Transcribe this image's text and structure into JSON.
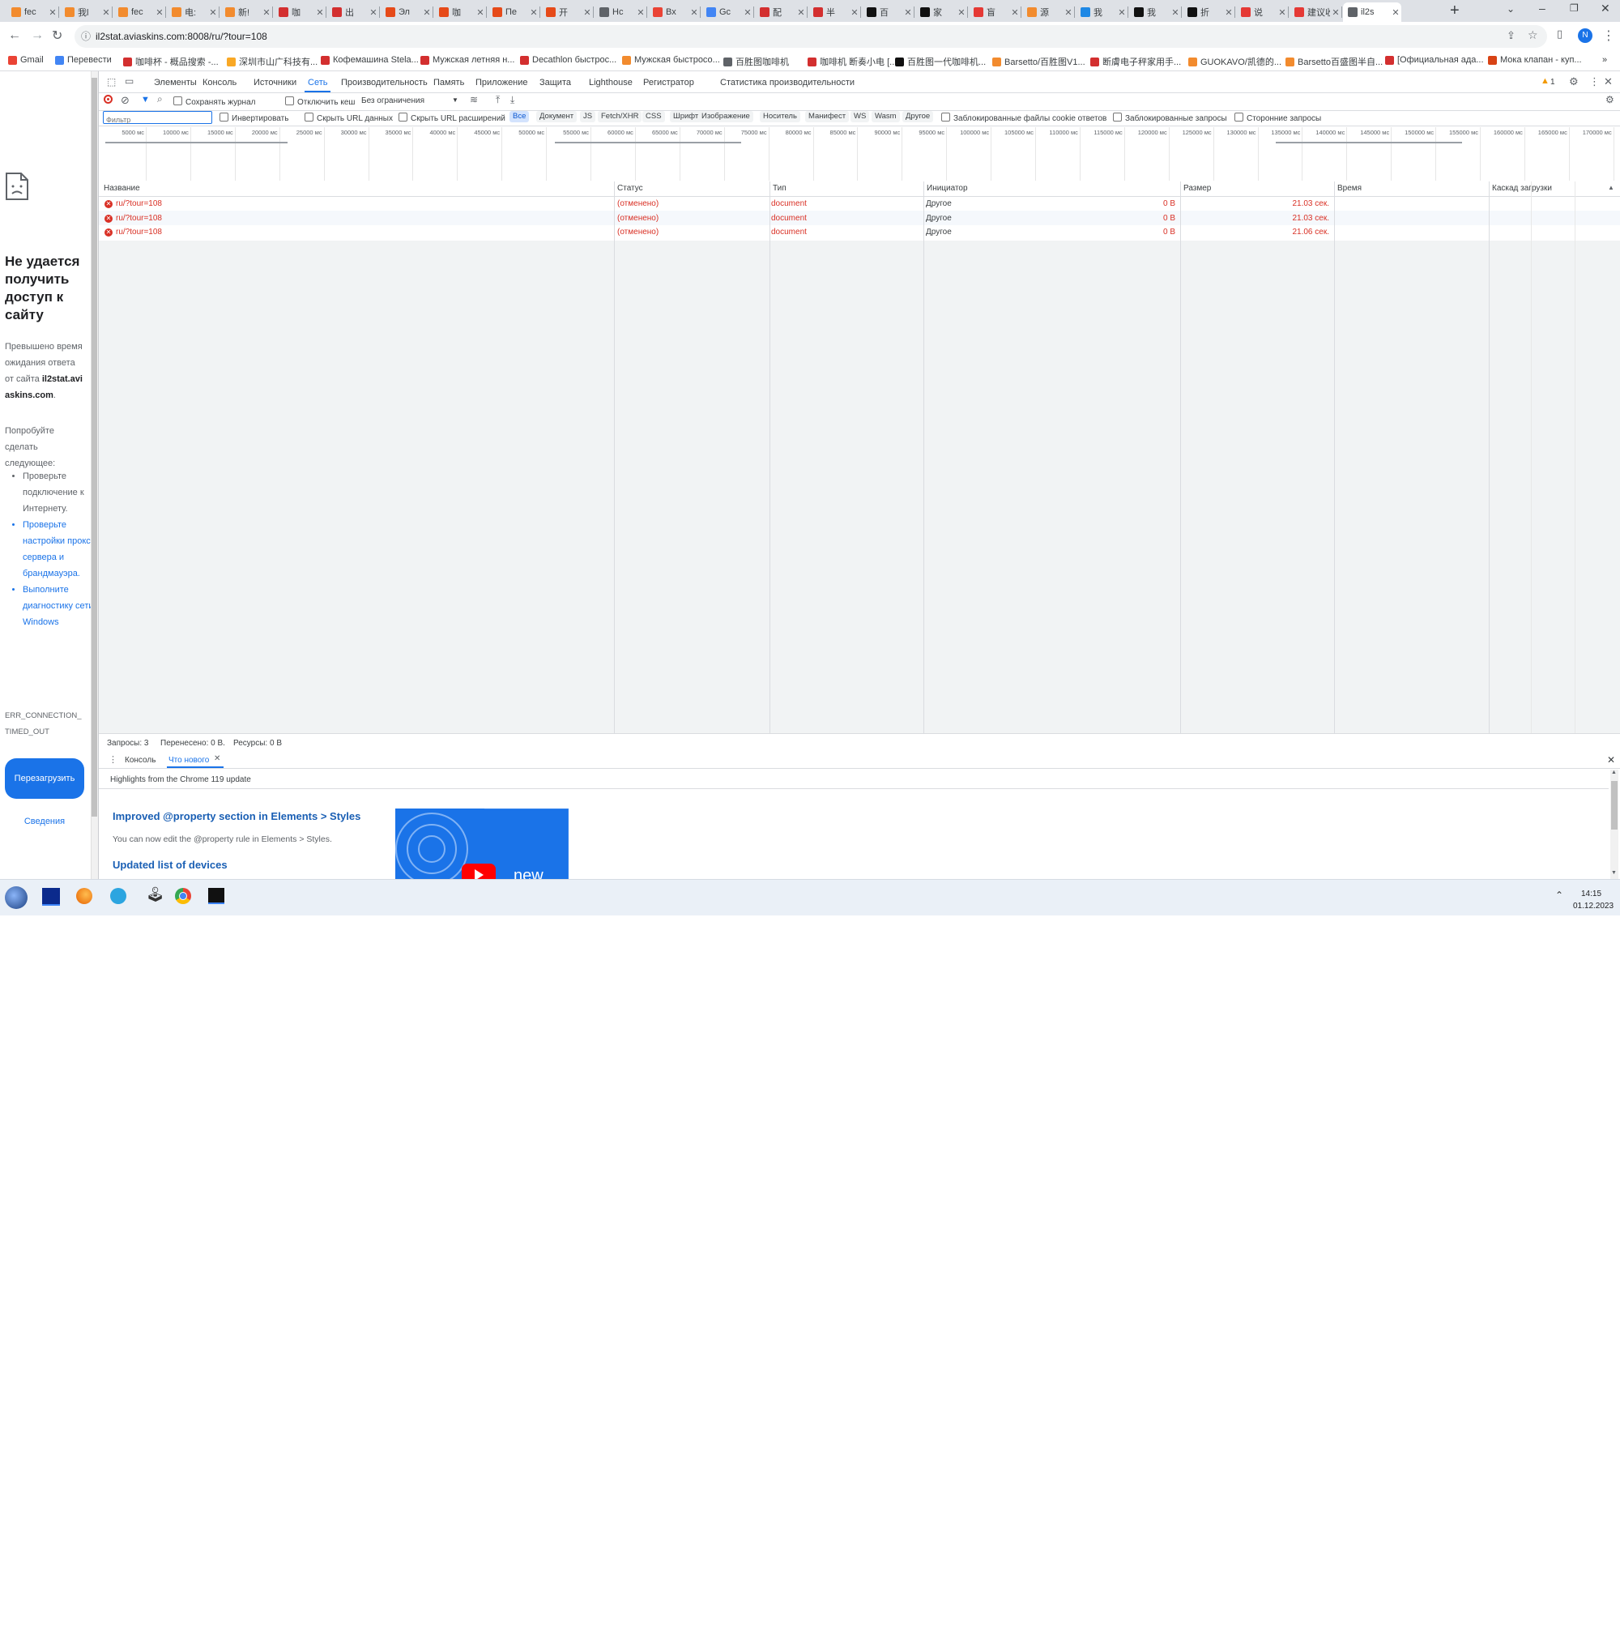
{
  "browser": {
    "tabs": [
      {
        "title": "fec",
        "color": "#f28b2e"
      },
      {
        "title": "我l",
        "color": "#f28b2e"
      },
      {
        "title": "fec",
        "color": "#f28b2e"
      },
      {
        "title": "电:",
        "color": "#f28b2e"
      },
      {
        "title": "新!",
        "color": "#f28b2e"
      },
      {
        "title": "咖",
        "color": "#d32f2f"
      },
      {
        "title": "出",
        "color": "#d32f2f"
      },
      {
        "title": "Эл",
        "color": "#e64a19"
      },
      {
        "title": "咖",
        "color": "#e64a19"
      },
      {
        "title": "Пе",
        "color": "#e64a19"
      },
      {
        "title": "开",
        "color": "#e64a19"
      },
      {
        "title": "Нс",
        "color": "#5f6368"
      },
      {
        "title": "Вх",
        "color": "#ea4335"
      },
      {
        "title": "Gc",
        "color": "#4285f4"
      },
      {
        "title": "配",
        "color": "#d32f2f"
      },
      {
        "title": "半",
        "color": "#d32f2f"
      },
      {
        "title": "百",
        "color": "#111111"
      },
      {
        "title": "家",
        "color": "#111111"
      },
      {
        "title": "盲",
        "color": "#e53935"
      },
      {
        "title": "源",
        "color": "#f28b2e"
      },
      {
        "title": "我",
        "color": "#1e88e5"
      },
      {
        "title": "我",
        "color": "#111111"
      },
      {
        "title": "折",
        "color": "#111111"
      },
      {
        "title": "说",
        "color": "#e53935"
      },
      {
        "title": "建议收",
        "color": "#e53935"
      },
      {
        "title": "il2s",
        "color": "#5f6368",
        "active": true
      }
    ],
    "url": "il2stat.aviaskins.com:8008/ru/?tour=108",
    "bookmarks": [
      {
        "label": "Gmail",
        "color": "#ea4335"
      },
      {
        "label": "Перевести",
        "color": "#4285f4"
      },
      {
        "label": "咖啡杯 - 概品搜索 -...",
        "color": "#d32f2f"
      },
      {
        "label": "深圳市山广科技有...",
        "color": "#f9a825"
      },
      {
        "label": "Кофемашина Stela...",
        "color": "#d32f2f"
      },
      {
        "label": "Мужская летняя н...",
        "color": "#d32f2f"
      },
      {
        "label": "Decathlon быстрос...",
        "color": "#d32f2f"
      },
      {
        "label": "Мужская быстросо...",
        "color": "#f28b2e"
      },
      {
        "label": "百胜图咖啡机",
        "color": "#5f6368"
      },
      {
        "label": "咖啡机 断奏小电 [...",
        "color": "#d32f2f"
      },
      {
        "label": "百胜图一代咖啡机...",
        "color": "#111111"
      },
      {
        "label": "Barsetto/百胜图V1...",
        "color": "#f28b2e"
      },
      {
        "label": "断膚电子秤家用手...",
        "color": "#d32f2f"
      },
      {
        "label": "GUOKAVO/凯德的...",
        "color": "#f28b2e"
      },
      {
        "label": "Barsetto百盛图半自...",
        "color": "#f28b2e"
      },
      {
        "label": "[Официальная ада...",
        "color": "#d32f2f"
      },
      {
        "label": "Мока клапан - куп...",
        "color": "#d84315"
      }
    ],
    "more": "»",
    "profile": "N"
  },
  "error_page": {
    "title": "Не удается получить доступ к сайту",
    "desc_line1": "Превышено время ожидания ответа от сайта",
    "host": "il2stat.aviaskins.com",
    "try_label": "Попробуйте сделать следующее:",
    "tips": [
      "Проверьте подключение к Интернету.",
      "Проверьте настройки прокси-сервера и брандмауэра.",
      "Выполните диагностику сети в Windows"
    ],
    "error_code": "ERR_CONNECTION_TIMED_OUT",
    "reload_label": "Перезагрузить",
    "details_label": "Сведения"
  },
  "devtools": {
    "tabs": [
      "Элементы",
      "Консоль",
      "Источники",
      "Сеть",
      "Производительность",
      "Память",
      "Приложение",
      "Защита",
      "Lighthouse",
      "Регистратор",
      "Статистика производительности"
    ],
    "active_tab": "Сеть",
    "warning_count": "1",
    "toolbar": {
      "preserve_log": "Сохранять журнал",
      "disable_cache": "Отключить кеш",
      "throttle": "Без ограничения"
    },
    "filter_placeholder": "Фильтр",
    "filter_options": {
      "invert": "Инвертировать",
      "hide_data_urls": "Скрыть URL данных",
      "hide_ext_urls": "Скрыть URL расширений"
    },
    "type_filters": [
      "Все",
      "Документ",
      "JS",
      "Fetch/XHR",
      "CSS",
      "Шрифт",
      "Изображение",
      "Носитель",
      "Манифест",
      "WS",
      "Wasm",
      "Другое"
    ],
    "extra_filters": {
      "blocked_cookies": "Заблокированные файлы cookie ответов",
      "blocked_requests": "Заблокированные запросы",
      "third_party": "Сторонние запросы"
    },
    "timeline_ticks": [
      "5000 мс",
      "10000 мс",
      "15000 мс",
      "20000 мс",
      "25000 мс",
      "30000 мс",
      "35000 мс",
      "40000 мс",
      "45000 мс",
      "50000 мс",
      "55000 мс",
      "60000 мс",
      "65000 мс",
      "70000 мс",
      "75000 мс",
      "80000 мс",
      "85000 мс",
      "90000 мс",
      "95000 мс",
      "100000 мс",
      "105000 мс",
      "110000 мс",
      "115000 мс",
      "120000 мс",
      "125000 мс",
      "130000 мс",
      "135000 мс",
      "140000 мс",
      "145000 мс",
      "150000 мс",
      "155000 мс",
      "160000 мс",
      "165000 мс",
      "170000 мс"
    ],
    "columns": [
      "Название",
      "Статус",
      "Тип",
      "Инициатор",
      "Размер",
      "Время",
      "Каскад загрузки"
    ],
    "rows": [
      {
        "name": "ru/?tour=108",
        "status": "(отменено)",
        "type": "document",
        "initiator": "Другое",
        "size": "0 B",
        "time": "21.03 сек."
      },
      {
        "name": "ru/?tour=108",
        "status": "(отменено)",
        "type": "document",
        "initiator": "Другое",
        "size": "0 B",
        "time": "21.03 сек."
      },
      {
        "name": "ru/?tour=108",
        "status": "(отменено)",
        "type": "document",
        "initiator": "Другое",
        "size": "0 B",
        "time": "21.06 сек."
      }
    ],
    "summary": {
      "requests": "Запросы: 3",
      "transferred": "Перенесено: 0 B.",
      "resources": "Ресурсы: 0 B"
    },
    "drawer": {
      "tabs": [
        "Консоль",
        "Что нового"
      ],
      "active": "Что нового",
      "highlights": "Highlights from the Chrome 119 update",
      "item1_title": "Improved @property section in Elements > Styles",
      "item1_desc": "You can now edit the @property rule in Elements > Styles.",
      "item2_title": "Updated list of devices",
      "video_label": "new"
    }
  },
  "taskbar": {
    "time": "14:15",
    "date": "01.12.2023"
  }
}
